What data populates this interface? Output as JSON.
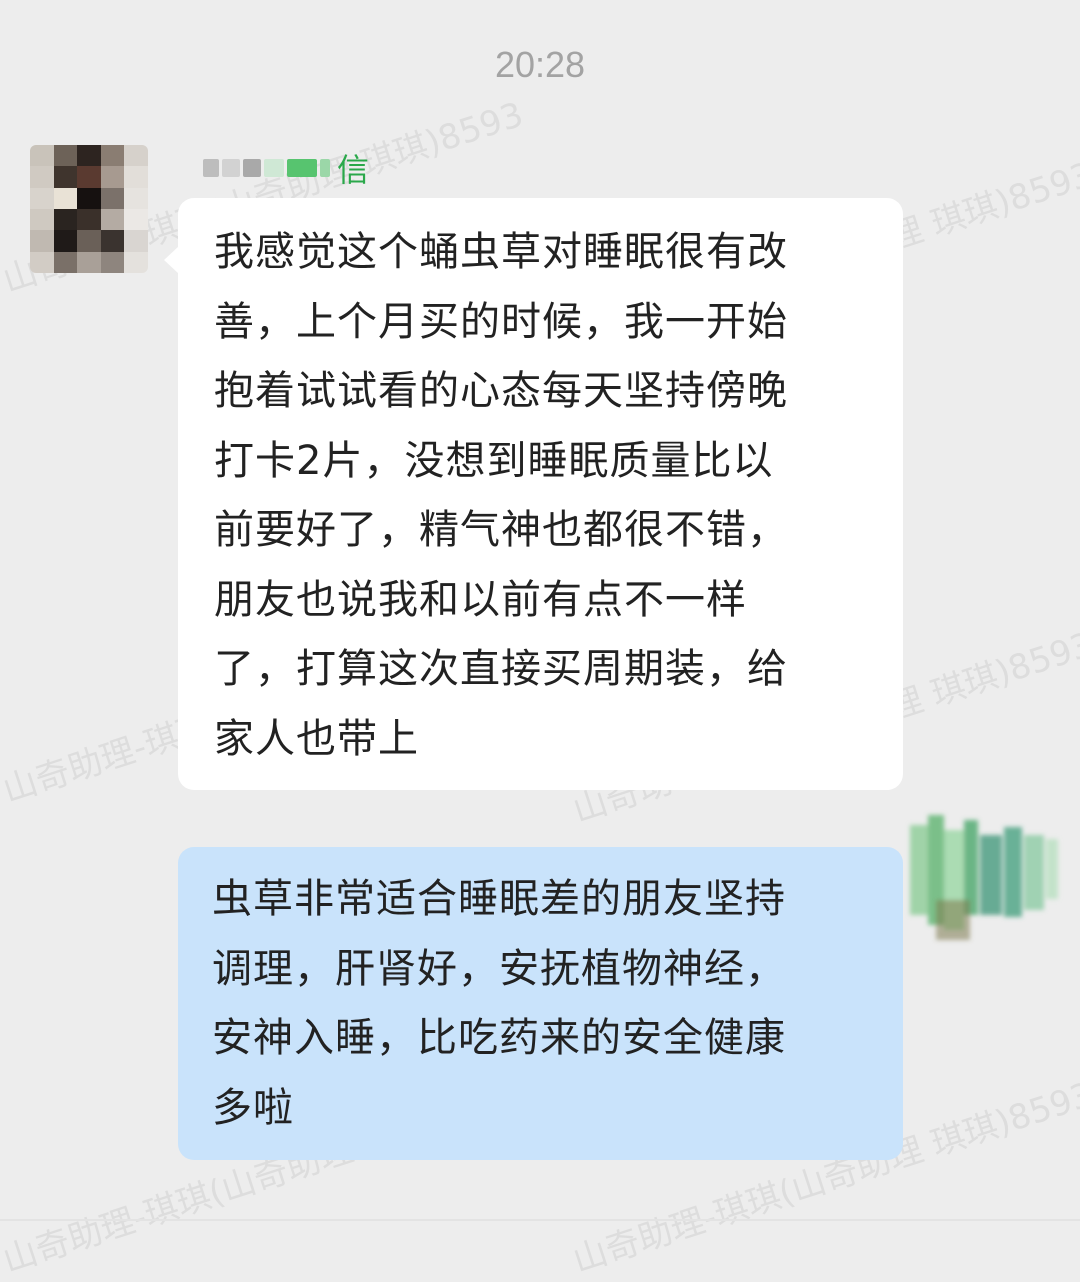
{
  "timestamp": "20:28",
  "watermark_text": "山奇助理-琪琪(山奇助理 琪琪)8593",
  "incoming": {
    "sender_visible": "信",
    "lines": [
      "我感觉这个蛹虫草对睡眠很有改",
      "善，上个月买的时候，我一开始",
      "抱着试试看的心态每天坚持傍晚",
      "打卡2片，没想到睡眠质量比以",
      "前要好了，精气神也都很不错，",
      "朋友也说我和以前有点不一样",
      "了，打算这次直接买周期装，给",
      "家人也带上"
    ]
  },
  "outgoing": {
    "lines": [
      "虫草非常适合睡眠差的朋友坚持",
      "调理，肝肾好，安抚植物神经，",
      "安神入睡，比吃药来的安全健康",
      "多啦"
    ]
  },
  "colors": {
    "background": "#ededed",
    "incoming_bubble": "#ffffff",
    "outgoing_bubble": "#c9e3fb",
    "sender_name": "#2aa84a",
    "timestamp": "#a3a3a3"
  }
}
